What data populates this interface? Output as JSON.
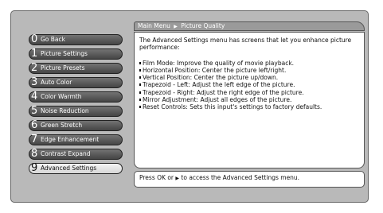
{
  "breadcrumb": {
    "root": "Main Menu",
    "separator_icon": "triangle-right-icon",
    "current": "Picture Quality"
  },
  "menu": {
    "selected_index": 9,
    "items": [
      {
        "number": "0",
        "label": "Go Back"
      },
      {
        "number": "1",
        "label": "Picture Settings"
      },
      {
        "number": "2",
        "label": "Picture Presets"
      },
      {
        "number": "3",
        "label": "Auto Color"
      },
      {
        "number": "4",
        "label": "Color Warmth"
      },
      {
        "number": "5",
        "label": "Noise Reduction"
      },
      {
        "number": "6",
        "label": "Green Stretch"
      },
      {
        "number": "7",
        "label": "Edge Enhancement"
      },
      {
        "number": "8",
        "label": "Contrast Expand"
      },
      {
        "number": "9",
        "label": "Advanced Settings"
      }
    ]
  },
  "content": {
    "intro": "The Advanced Settings menu has screens that let you enhance picture performance:",
    "bullets": [
      "Film Mode: Improve the quality of movie playback.",
      "Horizontal Position: Center the picture left/right.",
      "Vertical Position: Center the picture up/down.",
      "Trapezoid - Left: Adjust the left edge of the picture.",
      "Trapezoid - Right: Adjust the right edge of the picture.",
      "Mirror Adjustment: Adjust all edges of the picture.",
      "Reset Controls: Sets this input's settings to factory defaults."
    ]
  },
  "footer": {
    "prefix": "Press OK or",
    "suffix": "to access the Advanced Settings menu.",
    "arrow_icon": "triangle-right-icon"
  },
  "colors": {
    "panel": "#b9b9b9",
    "menu_button": "#555555",
    "menu_button_selected": "#e8e8e8",
    "content_bg": "#ffffff"
  }
}
